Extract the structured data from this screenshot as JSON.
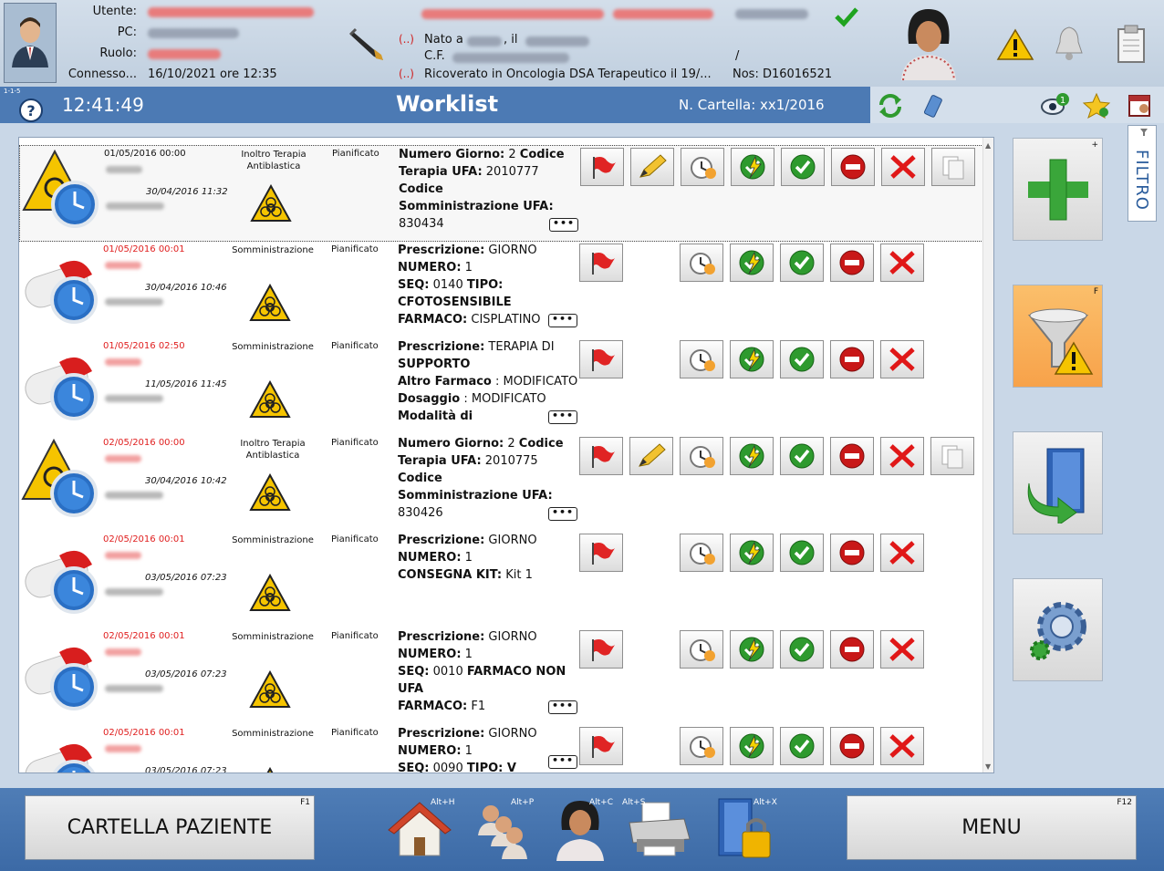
{
  "header": {
    "labels": {
      "user": "Utente:",
      "pc": "PC:",
      "role": "Ruolo:",
      "connected": "Connesso..."
    },
    "connected_value": "16/10/2021 ore 12:35",
    "patient_marker": "(..)",
    "born_prefix": "Nato a",
    "born_sep": ", il",
    "cf_label": "C.F.",
    "slash": "/",
    "admission": "Ricoverato in Oncologia DSA Terapeutico il 19/...",
    "nos": "Nos: D16016521",
    "status_color": "#1fa31f"
  },
  "bar": {
    "version": "1-1-5",
    "clock": "12:41:49",
    "title": "Worklist",
    "folder": "N. Cartella: xx1/2016"
  },
  "filter_tab": {
    "label": "FILTRO"
  },
  "rows": [
    {
      "date": "01/05/2016 00:00",
      "date_red": false,
      "time2": "30/04/2016 11:32",
      "type": "Inoltro Terapia Antiblastica",
      "state": "Pianificato",
      "icon": "warning-clock-icon",
      "lines": [
        [
          "Numero Giorno:",
          " 2 ",
          "Codice"
        ],
        [
          "Terapia UFA:",
          " 2010777",
          ""
        ],
        [
          "",
          "",
          "Codice"
        ],
        [
          "Somministrazione UFA:",
          "",
          ""
        ],
        [
          "",
          "830434",
          ""
        ]
      ]
    },
    {
      "date": "01/05/2016 00:01",
      "date_red": true,
      "time2": "30/04/2016 10:46",
      "type": "Somministrazione",
      "state": "Pianificato",
      "icon": "pill-clock-icon",
      "lines": [
        [
          "Prescrizione:",
          " GIORNO",
          ""
        ],
        [
          "NUMERO:",
          " 1",
          ""
        ],
        [
          "SEQ:",
          " 0140 ",
          "TIPO:"
        ],
        [
          "CFOTOSENSIBILE",
          "",
          ""
        ],
        [
          "FARMACO:",
          " CISPLATINO",
          ""
        ]
      ]
    },
    {
      "date": "01/05/2016 02:50",
      "date_red": true,
      "time2": "11/05/2016 11:45",
      "type": "Somministrazione",
      "state": "Pianificato",
      "icon": "pill-clock-icon",
      "lines": [
        [
          "Prescrizione:",
          " TERAPIA DI",
          ""
        ],
        [
          "SUPPORTO",
          "",
          ""
        ],
        [
          "Altro Farmaco",
          " : MODIFICATO",
          ""
        ],
        [
          "Dosaggio",
          " : MODIFICATO",
          ""
        ],
        [
          "Modalità di",
          "",
          ""
        ]
      ]
    },
    {
      "date": "02/05/2016 00:00",
      "date_red": true,
      "time2": "30/04/2016 10:42",
      "type": "Inoltro Terapia Antiblastica",
      "state": "Pianificato",
      "icon": "warning-clock-icon",
      "lines": [
        [
          "Numero Giorno:",
          " 2 ",
          "Codice"
        ],
        [
          "Terapia UFA:",
          " 2010775",
          ""
        ],
        [
          "",
          "",
          "Codice"
        ],
        [
          "Somministrazione UFA:",
          "",
          ""
        ],
        [
          "",
          "830426",
          ""
        ]
      ]
    },
    {
      "date": "02/05/2016 00:01",
      "date_red": true,
      "time2": "03/05/2016 07:23",
      "type": "Somministrazione",
      "state": "Pianificato",
      "icon": "pill-clock-icon",
      "lines": [
        [
          "Prescrizione:",
          " GIORNO",
          ""
        ],
        [
          "NUMERO:",
          " 1",
          ""
        ],
        [
          "CONSEGNA KIT:",
          " Kit 1",
          ""
        ]
      ]
    },
    {
      "date": "02/05/2016 00:01",
      "date_red": true,
      "time2": "03/05/2016 07:23",
      "type": "Somministrazione",
      "state": "Pianificato",
      "icon": "pill-clock-icon",
      "lines": [
        [
          "Prescrizione:",
          " GIORNO",
          ""
        ],
        [
          "NUMERO:",
          " 1",
          ""
        ],
        [
          "SEQ:",
          " 0010 ",
          "FARMACO NON"
        ],
        [
          "UFA",
          "",
          ""
        ],
        [
          "FARMACO:",
          " F1",
          ""
        ]
      ]
    },
    {
      "date": "02/05/2016 00:01",
      "date_red": true,
      "time2": "03/05/2016 07:23",
      "type": "Somministrazione",
      "state": "Pianificato",
      "icon": "pill-clock-icon",
      "lines": [
        [
          "Prescrizione:",
          " GIORNO",
          ""
        ],
        [
          "NUMERO:",
          " 1",
          ""
        ],
        [
          "SEQ:",
          " 0090 ",
          "TIPO: V"
        ]
      ]
    }
  ],
  "more_label": "•••",
  "side_keys": {
    "add": "+",
    "filter": "F"
  },
  "footer": {
    "left_button": "CARTELLA PAZIENTE",
    "left_key": "F1",
    "right_button": "MENU",
    "right_key": "F12",
    "keys": {
      "home": "Alt+H",
      "patients": "Alt+P",
      "contact": "Alt+C",
      "print": "Alt+S",
      "lock": "Alt+X"
    }
  },
  "colors": {
    "accent": "#4c7ab4",
    "red_date": "#e02020"
  }
}
